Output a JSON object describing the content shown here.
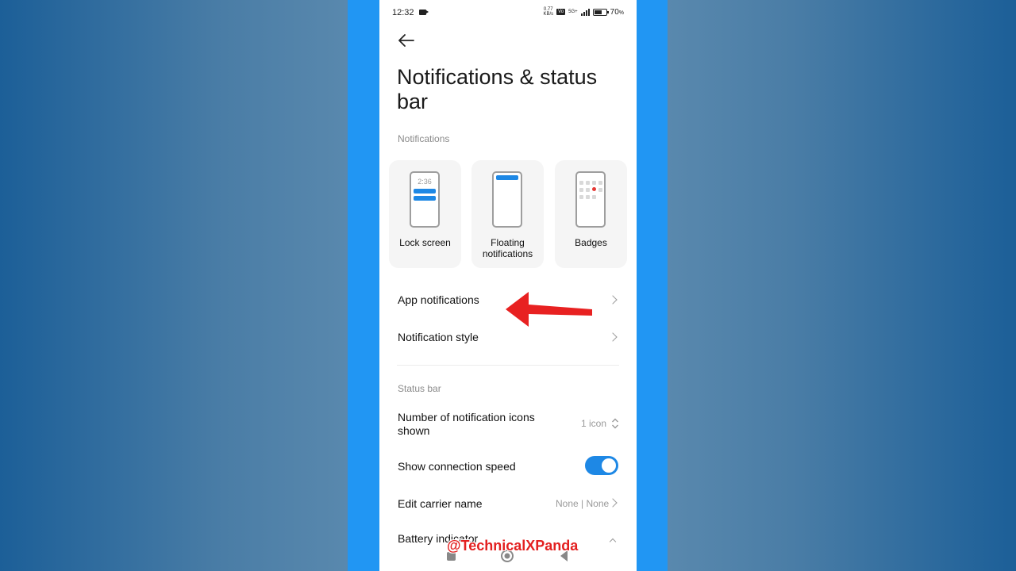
{
  "status_bar": {
    "time": "12:32",
    "speed_value": "0.77",
    "speed_unit": "KB/s",
    "volte": "Vo",
    "network": "5G+",
    "battery_pct": "70",
    "battery_suffix": "%",
    "battery_level": 0.7
  },
  "header": {
    "title": "Notifications & status bar"
  },
  "notifications_section": {
    "label": "Notifications",
    "cards": [
      {
        "label": "Lock screen",
        "mini_time": "2:36"
      },
      {
        "label": "Floating notifications"
      },
      {
        "label": "Badges"
      }
    ],
    "items": [
      {
        "label": "App notifications"
      },
      {
        "label": "Notification style"
      }
    ]
  },
  "status_bar_section": {
    "label": "Status bar",
    "items": [
      {
        "label": "Number of notification icons shown",
        "value": "1 icon"
      },
      {
        "label": "Show connection speed",
        "toggle_on": true
      },
      {
        "label": "Edit carrier name",
        "value": "None | None"
      },
      {
        "label": "Battery indicator"
      }
    ]
  },
  "watermark": "@TechnicalXPanda",
  "colors": {
    "accent": "#1e88e5",
    "frame": "#2196f3",
    "annotation": "#e32020"
  }
}
